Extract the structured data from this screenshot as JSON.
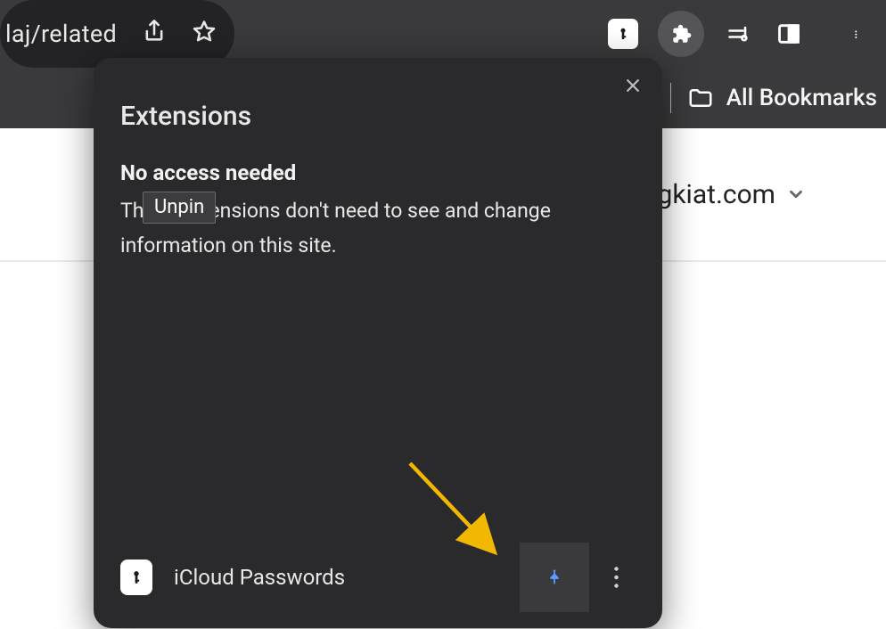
{
  "chrome": {
    "url_fragment": "laj/related",
    "all_bookmarks": "All Bookmarks"
  },
  "page": {
    "domain_fragment": "gkiat.com"
  },
  "popup": {
    "title": "Extensions",
    "section_heading": "No access needed",
    "section_desc": "These extensions don't need to see and change information on this site.",
    "tooltip": "Unpin",
    "extension": {
      "name": "iCloud Passwords"
    }
  }
}
